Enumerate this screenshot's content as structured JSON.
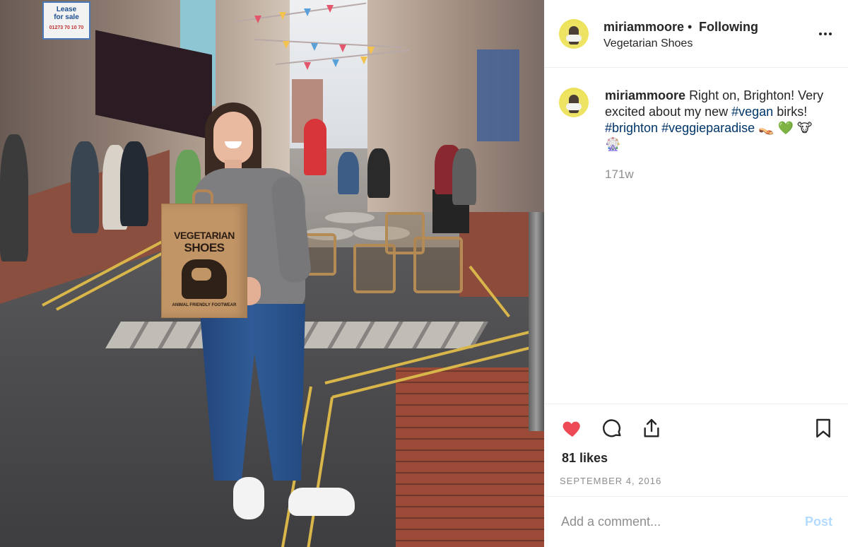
{
  "post": {
    "username": "miriammoore",
    "separator": "•",
    "follow_status": "Following",
    "location": "Vegetarian Shoes",
    "more_icon": "ellipsis-icon",
    "caption": {
      "username": "miriammoore",
      "text": "Right on, Brighton! Very excited about my new",
      "tag1": "#vegan",
      "text2": "birks!",
      "tag2": "#brighton",
      "tag3": "#veggieparadise",
      "emojis": "👡 💚 🐮 🎡"
    },
    "time_ago": "171w",
    "likes": "81 likes",
    "date": "SEPTEMBER 4, 2016",
    "comment_placeholder": "Add a comment...",
    "post_button": "Post"
  },
  "photo": {
    "lease_sign": {
      "line1": "Lease",
      "line2": "for sale",
      "tel": "01273 70 10 70"
    },
    "bag": {
      "line1": "VEGETARIAN",
      "line2": "SHOES",
      "foot": "ANIMAL FRIENDLY FOOTWEAR"
    }
  },
  "colors": {
    "heart": "#ed4956",
    "hashtag": "#003569",
    "muted": "#8e8e8e",
    "post_disabled": "#b3dbff",
    "avatar_bg": "#efe45f"
  }
}
